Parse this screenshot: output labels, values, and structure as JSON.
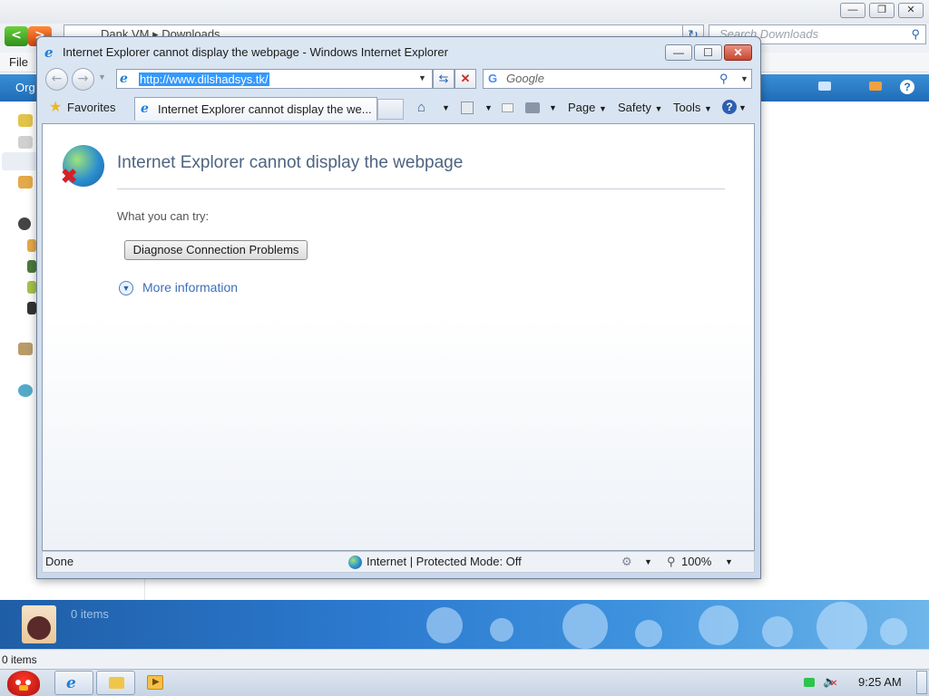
{
  "explorer": {
    "breadcrumb": [
      "Dank VM",
      "Downloads"
    ],
    "search_placeholder": "Search Downloads",
    "menu": {
      "file": "File",
      "organize": "Org"
    },
    "items_count_banner": "0 items",
    "status_items": "0 items",
    "window_controls": {
      "minimize": "—",
      "maximize": "❐",
      "close": "✕"
    }
  },
  "ie": {
    "title": "Internet Explorer cannot display the webpage - Windows Internet Explorer",
    "url": "http://www.dilshadsys.tk/",
    "search_placeholder": "Google",
    "favorites_label": "Favorites",
    "tab_label": "Internet Explorer cannot display the we...",
    "commands": {
      "page": "Page",
      "safety": "Safety",
      "tools": "Tools"
    },
    "content": {
      "heading": "Internet Explorer cannot display the webpage",
      "try_label": "What you can try:",
      "diagnose_button": "Diagnose Connection Problems",
      "more_info": "More information"
    },
    "status": {
      "done": "Done",
      "zone": "Internet | Protected Mode: Off",
      "zoom": "100%"
    },
    "window_controls": {
      "minimize": "—",
      "maximize": "☐",
      "close": "✕"
    }
  },
  "taskbar": {
    "clock": "9:25 AM"
  },
  "colors": {
    "url_highlight": "#3399ff",
    "heading": "#4d6480",
    "link": "#3b6fb6",
    "close_button": "#c74632"
  }
}
